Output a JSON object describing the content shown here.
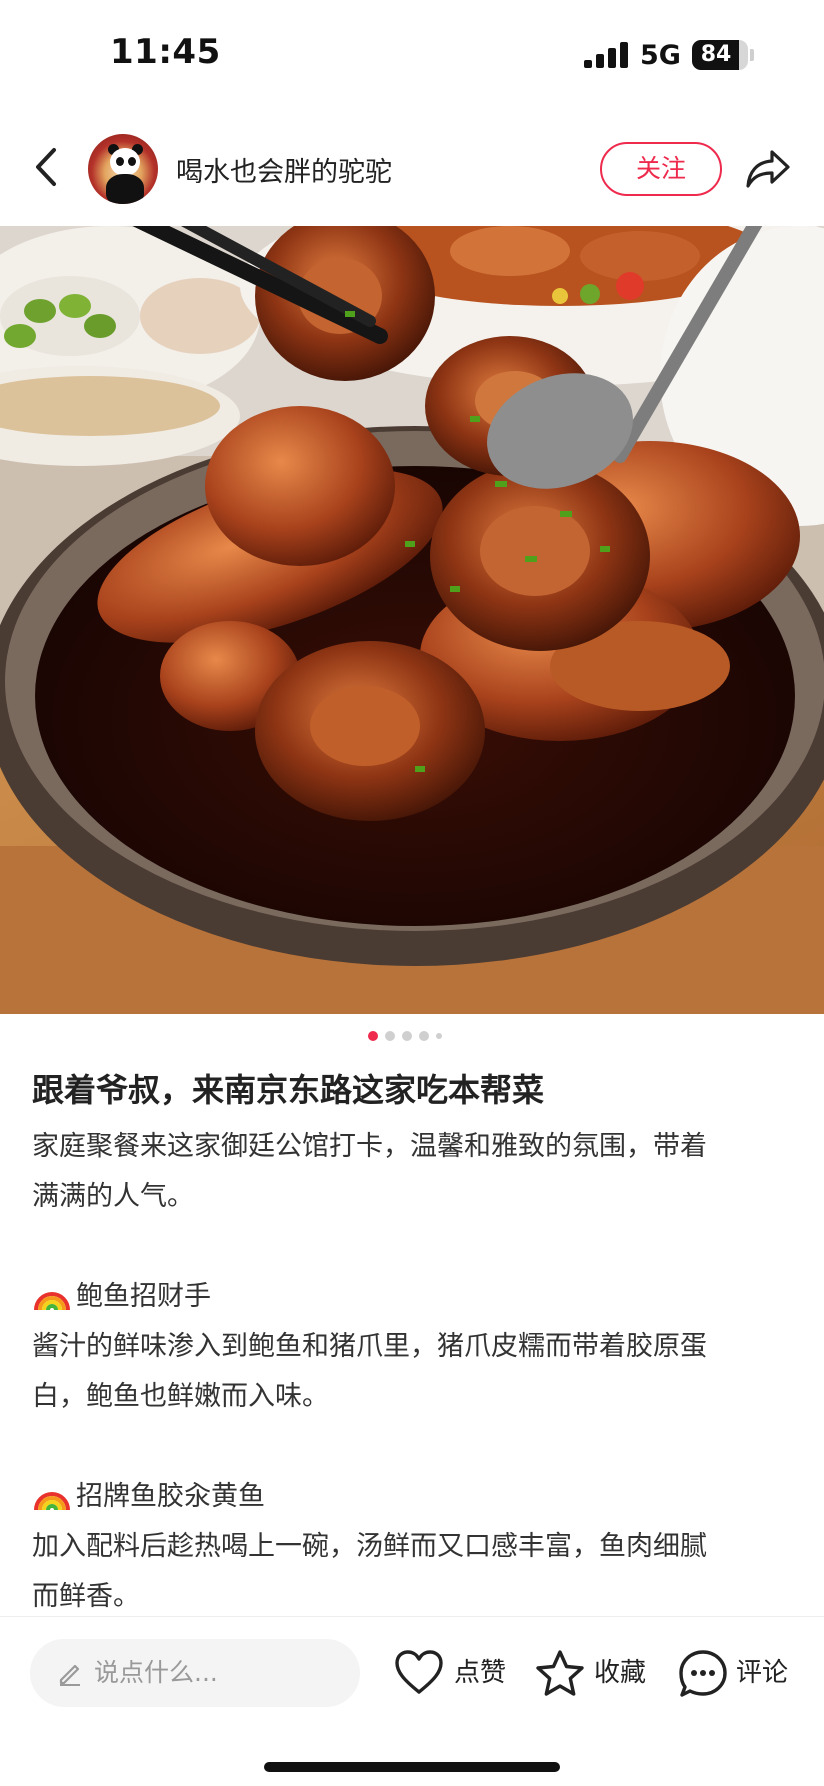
{
  "status_bar": {
    "time": "11:45",
    "network": "5G",
    "battery": "84",
    "battery_level": 0.84
  },
  "header": {
    "username": "喝水也会胖的驼驼",
    "follow_label": "关注",
    "icons": [
      "back-arrow-icon",
      "share-icon"
    ]
  },
  "carousel": {
    "total": 5,
    "active_index": 0,
    "active_color": "#ee2a4d"
  },
  "post": {
    "title": "跟着爷叔，来南京东路这家吃本帮菜",
    "intro_line1": "家庭聚餐来这家御廷公馆打卡，温馨和雅致的氛围，带着",
    "intro_line2": "满满的人气。",
    "section1_heading": "鲍鱼招财手",
    "section1_line1": "酱汁的鲜味渗入到鲍鱼和猪爪里，猪爪皮糯而带着胶原蛋",
    "section1_line2": "白，鲍鱼也鲜嫩而入味。",
    "section2_heading": "招牌鱼胶汆黄鱼",
    "section2_line1": "加入配料后趁热喝上一碗，汤鲜而又口感丰富，鱼肉细腻",
    "section2_line2": "而鲜香。",
    "section_icon": "rainbow-icon"
  },
  "bottom_bar": {
    "comment_placeholder": "说点什么...",
    "like_label": "点赞",
    "collect_label": "收藏",
    "comment_label": "评论"
  },
  "colors": {
    "accent": "#ee2a4d"
  }
}
